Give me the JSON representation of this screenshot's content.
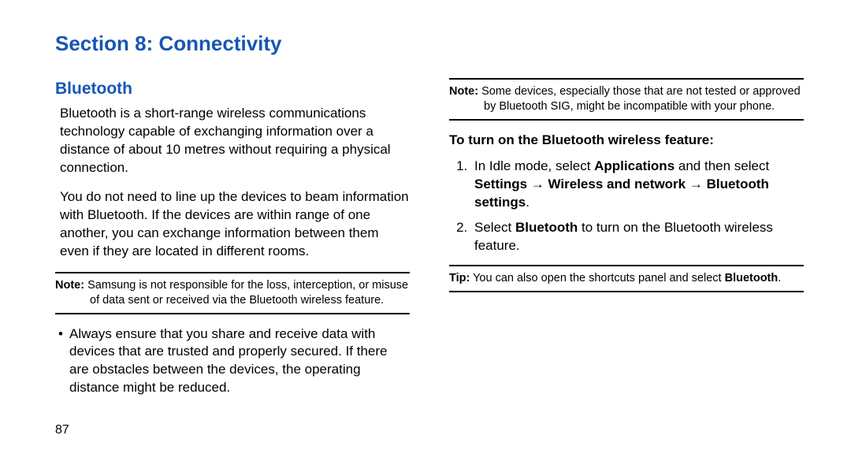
{
  "section_title": "Section 8: Connectivity",
  "subheading": "Bluetooth",
  "para1": "Bluetooth is a short-range wireless communications technology capable of exchanging information over a distance of about 10 metres without requiring a physical connection.",
  "para2": "You do not need to line up the devices to beam information with Bluetooth. If the devices are within range of one another, you can exchange information between them even if they are located in different rooms.",
  "note1_label": "Note:",
  "note1_first": "Samsung is not responsible for the loss, interception, or misuse",
  "note1_rest": "of data sent or received via the Bluetooth wireless feature.",
  "bullet1": "Always ensure that you share and receive data with devices that are trusted and properly secured. If there are obstacles between the devices, the operating distance might be reduced.",
  "note2_label": "Note:",
  "note2_first": "Some devices, especially those that are not tested or approved",
  "note2_rest": "by Bluetooth SIG, might be incompatible with your phone.",
  "turn_on_heading": "To turn on the Bluetooth wireless feature:",
  "step1_a": "In Idle mode, select ",
  "step1_b": "Applications",
  "step1_c": " and then select ",
  "step1_d": "Settings → Wireless and network → Bluetooth settings",
  "step1_e": ".",
  "step2_a": "Select ",
  "step2_b": "Bluetooth",
  "step2_c": " to turn on the Bluetooth wireless feature.",
  "tip_label": "Tip:",
  "tip_first": "You can also open the shortcuts panel and select ",
  "tip_bold": "Bluetooth",
  "tip_end": ".",
  "page_number": "87"
}
